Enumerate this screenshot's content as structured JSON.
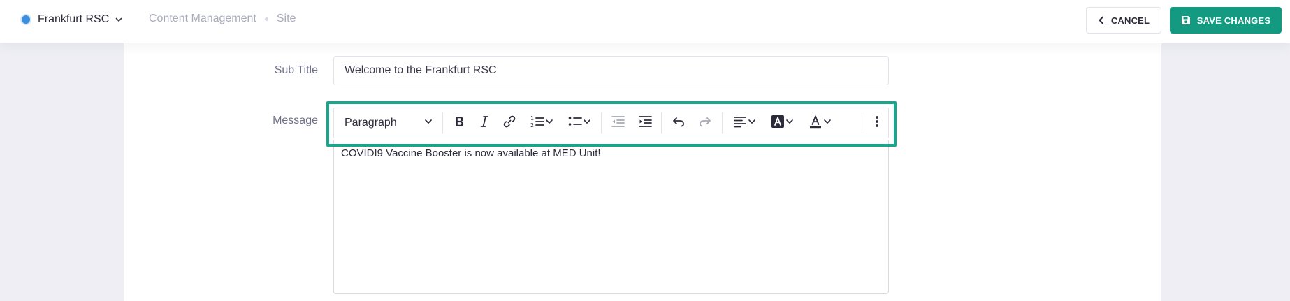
{
  "header": {
    "site_name": "Frankfurt RSC",
    "breadcrumb": [
      "Content Management",
      "Site"
    ],
    "cancel_label": "CANCEL",
    "save_label": "SAVE CHANGES"
  },
  "form": {
    "subtitle_label": "Sub Title",
    "subtitle_value": "Welcome to the Frankfurt RSC",
    "message_label": "Message",
    "message_text": "COVIDI9 Vaccine Booster is now available at MED Unit!"
  },
  "toolbar": {
    "block_format": "Paragraph",
    "buttons": [
      "bold",
      "italic",
      "link",
      "numbered-list",
      "bulleted-list",
      "outdent",
      "indent",
      "undo",
      "redo",
      "align",
      "highlight",
      "text-color",
      "more"
    ]
  },
  "colors": {
    "accent": "#159a82",
    "highlight_border": "#17a78c",
    "site_dot": "#3d8fdb"
  }
}
